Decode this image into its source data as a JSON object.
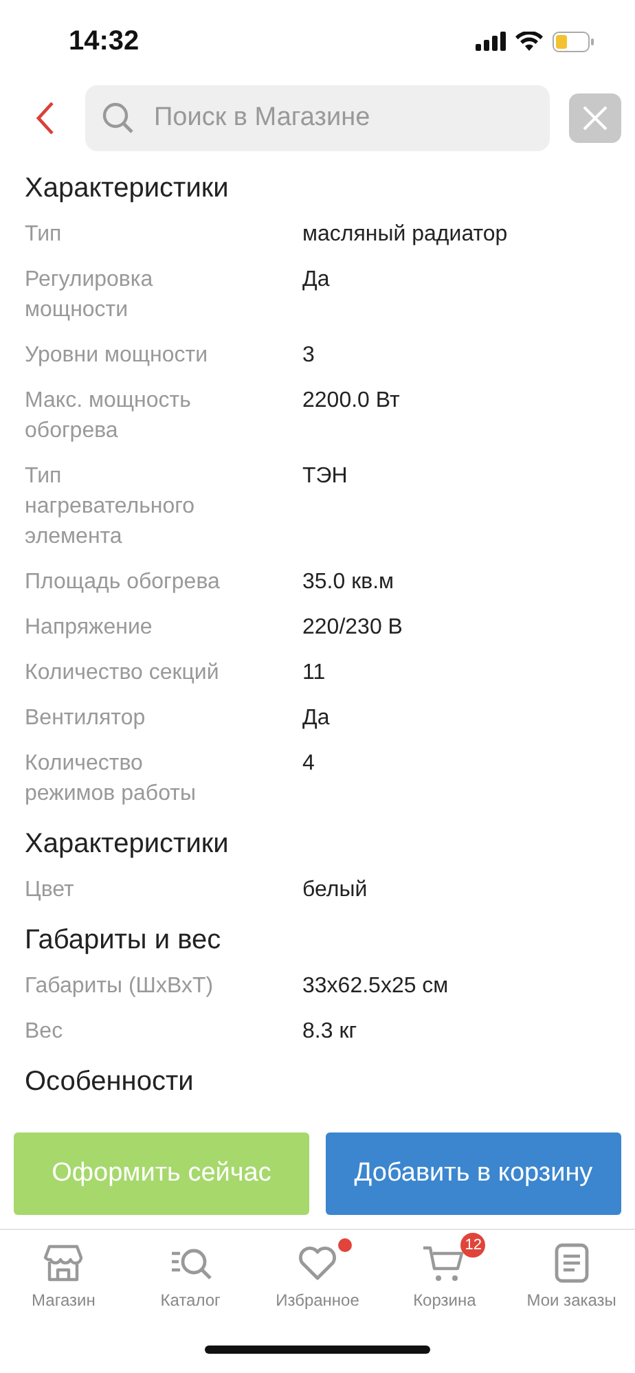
{
  "status_bar": {
    "time": "14:32"
  },
  "search": {
    "placeholder": "Поиск в Магазине"
  },
  "sections": [
    {
      "title": "Характеристики",
      "rows": [
        {
          "label": "Тип",
          "value": "масляный радиатор"
        },
        {
          "label": "Регулировка мощности",
          "value": "Да"
        },
        {
          "label": "Уровни мощности",
          "value": "3"
        },
        {
          "label": "Макс. мощность обогрева",
          "value": "2200.0 Вт"
        },
        {
          "label": "Тип нагревательного элемента",
          "value": "ТЭН"
        },
        {
          "label": "Площадь обогрева",
          "value": "35.0 кв.м"
        },
        {
          "label": "Напряжение",
          "value": "220/230 В"
        },
        {
          "label": "Количество секций",
          "value": "11"
        },
        {
          "label": "Вентилятор",
          "value": "Да"
        },
        {
          "label": "Количество режимов работы",
          "value": "4"
        }
      ]
    },
    {
      "title": "Характеристики",
      "rows": [
        {
          "label": "Цвет",
          "value": "белый"
        }
      ]
    },
    {
      "title": "Габариты и вес",
      "rows": [
        {
          "label": "Габариты (ШхВхТ)",
          "value": "33x62.5x25 см"
        },
        {
          "label": "Вес",
          "value": "8.3 кг"
        }
      ]
    },
    {
      "title": "Особенности"
    }
  ],
  "actions": [
    {
      "kind": "buy",
      "label": "Оформить сейчас"
    },
    {
      "kind": "cart",
      "label": "Добавить в корзину"
    }
  ],
  "nav": [
    {
      "kind": "shop",
      "label": "Магазин",
      "dot": false
    },
    {
      "kind": "catalog",
      "label": "Каталог",
      "dot": false
    },
    {
      "kind": "favorites",
      "label": "Избранное",
      "dot": true
    },
    {
      "kind": "cart",
      "label": "Корзина",
      "dot": false,
      "badge": "12"
    },
    {
      "kind": "orders",
      "label": "Мои заказы",
      "dot": false
    }
  ]
}
